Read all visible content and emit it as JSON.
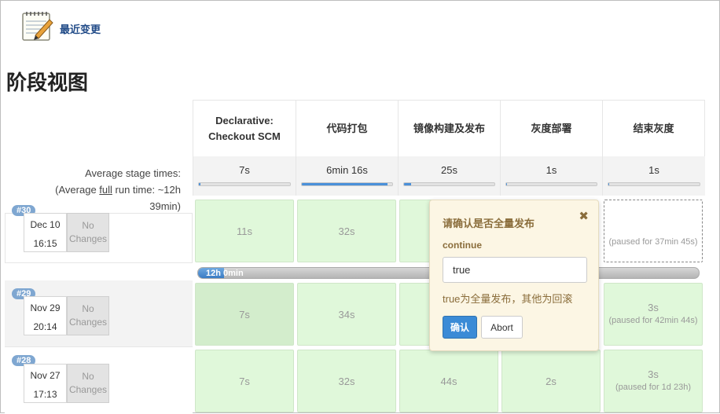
{
  "top": {
    "recent_changes_label": "最近变更"
  },
  "page_title": "阶段视图",
  "stages": [
    {
      "line1": "Declarative:",
      "line2": "Checkout SCM",
      "avg": "7s",
      "avg_fraction": 0.02
    },
    {
      "line1": "代码打包",
      "line2": "",
      "avg": "6min 16s",
      "avg_fraction": 0.95
    },
    {
      "line1": "镜像构建及发布",
      "line2": "",
      "avg": "25s",
      "avg_fraction": 0.08
    },
    {
      "line1": "灰度部署",
      "line2": "",
      "avg": "1s",
      "avg_fraction": 0.01
    },
    {
      "line1": "结束灰度",
      "line2": "",
      "avg": "1s",
      "avg_fraction": 0.01
    }
  ],
  "avg": {
    "label": "Average stage times:",
    "full_prefix": "(Average ",
    "full_word": "full",
    "full_suffix": " run time: ~12h",
    "full_tail": "39min)"
  },
  "runs": [
    {
      "badge": "#30",
      "date": "Dec 10",
      "time": "16:15",
      "no_changes": "No Changes",
      "cells": [
        {
          "main": "11s"
        },
        {
          "main": "32s"
        },
        {
          "main": ""
        },
        {
          "main": ""
        },
        {
          "main": "",
          "sub": "(paused for 37min 45s)"
        }
      ]
    },
    {
      "badge": "#29",
      "date": "Nov 29",
      "time": "20:14",
      "no_changes": "No Changes",
      "cells": [
        {
          "main": "7s"
        },
        {
          "main": "34s"
        },
        {
          "main": ""
        },
        {
          "main": ""
        },
        {
          "main": "3s",
          "sub": "(paused for 42min 44s)"
        }
      ]
    },
    {
      "badge": "#28",
      "date": "Nov 27",
      "time": "17:13",
      "no_changes": "No Changes",
      "cells": [
        {
          "main": "7s"
        },
        {
          "main": "32s"
        },
        {
          "main": "44s"
        },
        {
          "main": "2s"
        },
        {
          "main": "3s",
          "sub": "(paused for 1d 23h)"
        }
      ]
    }
  ],
  "run_progress": {
    "label": "12h 0min",
    "fraction": 0.05
  },
  "popover": {
    "title": "请确认是否全量发布",
    "close": "✖",
    "param_name": "continue",
    "input_value": "true",
    "description": "true为全量发布，其他为回滚",
    "ok_label": "确认",
    "abort_label": "Abort"
  },
  "colors": {
    "success_cell": "#e0f8da",
    "success_cell_dark": "#d3edcc",
    "badge": "#7fa7d1",
    "progress_blue": "#3a7cc4",
    "popover_bg": "#fcf6e4",
    "popover_text": "#8a6d3b"
  }
}
